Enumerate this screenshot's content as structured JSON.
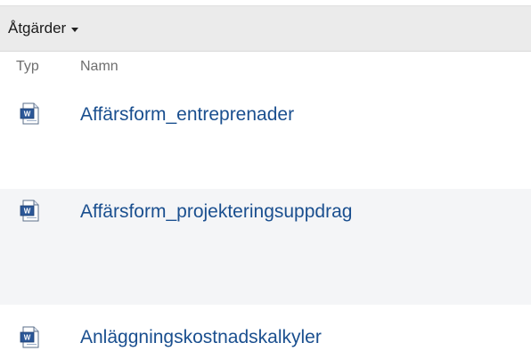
{
  "toolbar": {
    "actions_label": "Åtgärder"
  },
  "columns": {
    "type": "Typ",
    "name": "Namn"
  },
  "documents": [
    {
      "name": "Affärsform_entreprenader",
      "icon": "word-document-icon"
    },
    {
      "name": "Affärsform_projekteringsuppdrag",
      "icon": "word-document-icon"
    },
    {
      "name": "Anläggningskostnadskalkyler",
      "icon": "word-document-icon"
    }
  ],
  "colors": {
    "link": "#1a4f8f",
    "toolbar_bg": "#ebebeb",
    "alt_row_bg": "#f4f5f7"
  }
}
